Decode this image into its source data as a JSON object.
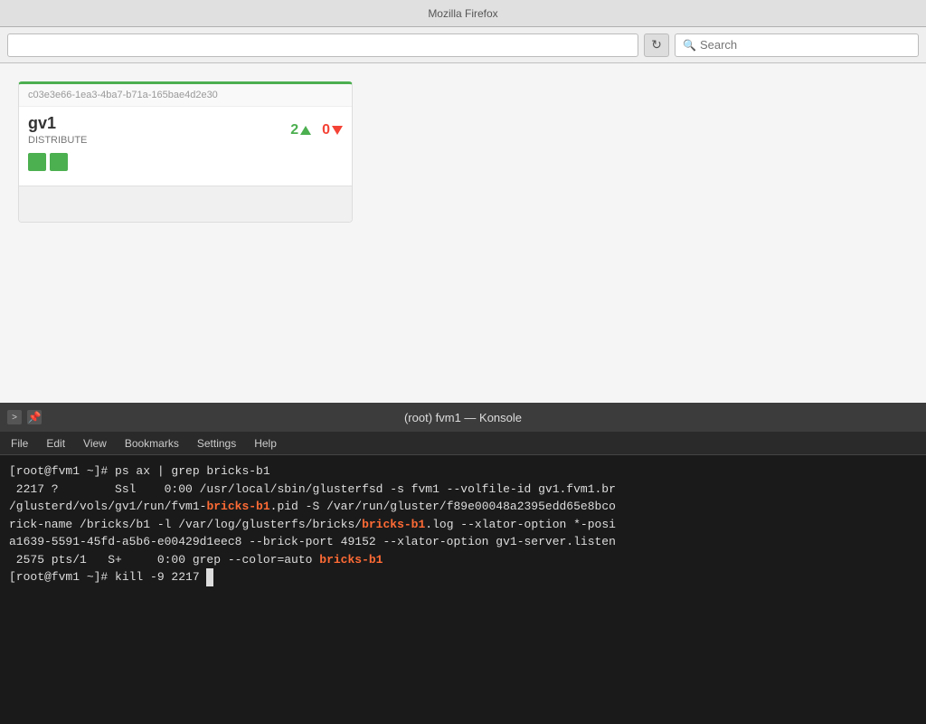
{
  "browser": {
    "title": "Mozilla Firefox",
    "reload_symbol": "↻",
    "search_placeholder": "Search"
  },
  "volume_card": {
    "hash": "c03e3e66-1ea3-4ba7-b71a-165bae4d2e30",
    "name": "gv1",
    "type": "DISTRIBUTE",
    "up_count": "2",
    "down_count": "0"
  },
  "terminal": {
    "title": "(root) fvm1 — Konsole",
    "menu_items": [
      "File",
      "Edit",
      "View",
      "Bookmarks",
      "Settings",
      "Help"
    ],
    "lines": [
      {
        "text": "[root@fvm1 ~]# ps ax | grep bricks-b1",
        "type": "normal"
      },
      {
        "text": " 2217 ?        Ssl    0:00 /usr/local/sbin/glusterfsd -s fvm1 --volfile-id gv1.fvm1.br",
        "type": "normal"
      },
      {
        "text_parts": [
          {
            "text": "/glusterd/vols/gv1/run/fvm1-",
            "type": "normal"
          },
          {
            "text": "bricks-b1",
            "type": "highlight"
          },
          {
            "text": ".pid -S /var/run/gluster/f89e00048a2395edd65e8bco",
            "type": "normal"
          }
        ]
      },
      {
        "text_parts": [
          {
            "text": "rick-name /bricks/b1 -l /var/log/glusterfs/bricks/",
            "type": "normal"
          },
          {
            "text": "bricks-b1",
            "type": "highlight"
          },
          {
            "text": ".log --xlator-option *-posi",
            "type": "normal"
          }
        ]
      },
      {
        "text": "a1639-5591-45fd-a5b6-e00429d1eec8 --brick-port 49152 --xlator-option gv1-server.listen",
        "type": "normal"
      },
      {
        "text_parts": [
          {
            "text": " 2575 pts/1   S+     0:00 grep --color=auto ",
            "type": "normal"
          },
          {
            "text": "bricks-b1",
            "type": "highlight"
          }
        ]
      },
      {
        "text_parts": [
          {
            "text": "[root@fvm1 ~]# kill -9 2217 ",
            "type": "normal"
          },
          {
            "text": "█",
            "type": "cursor"
          }
        ]
      }
    ]
  }
}
